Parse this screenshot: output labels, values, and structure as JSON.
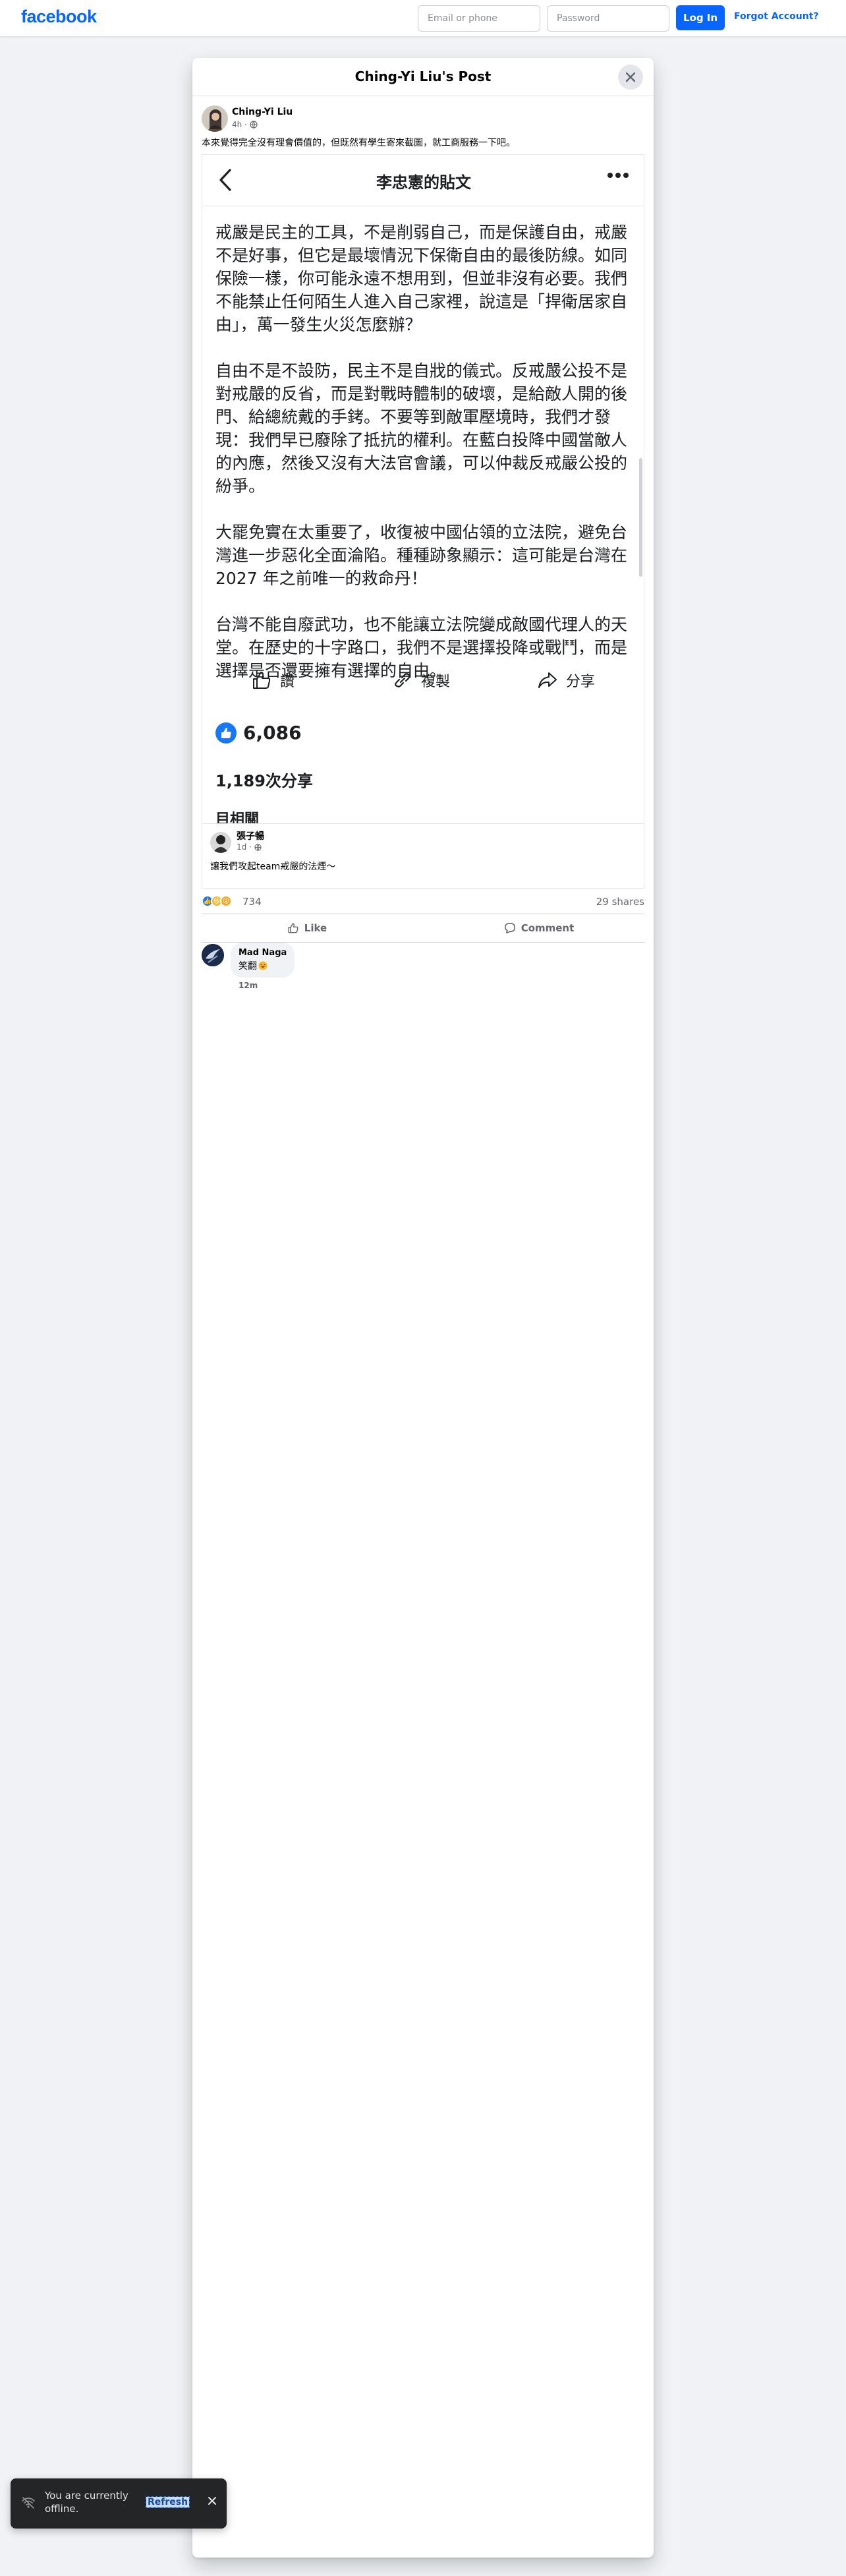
{
  "topbar": {
    "logo": "facebook",
    "email_placeholder": "Email or phone",
    "password_placeholder": "Password",
    "login_label": "Log In",
    "forgot_label": "Forgot Account?"
  },
  "modal": {
    "title": "Ching-Yi Liu's Post",
    "author": {
      "name": "Ching-Yi Liu",
      "meta": "4h ·"
    },
    "caption": "本來覺得完全沒有理會價值的，但既然有學生寄來截圖，就工商服務一下吧。",
    "embed": {
      "title": "李忠憲的貼文",
      "paragraphs": [
        "戒嚴是民主的工具，不是削弱自己，而是保護自由，戒嚴不是好事，但它是最壞情況下保衛自由的最後防線。如同保險一樣，你可能永遠不想用到，但並非沒有必要。我們不能禁止任何陌生人進入自己家裡，說這是「捍衛居家自由」，萬一發生火災怎麼辦？",
        "自由不是不設防，民主不是自戕的儀式。反戒嚴公投不是對戒嚴的反省，而是對戰時體制的破壞，是給敵人開的後門、給總統戴的手銬。不要等到敵軍壓境時，我們才發現：我們早已廢除了抵抗的權利。在藍白投降中國當敵人的內應，然後又沒有大法官會議，可以仲裁反戒嚴公投的紛爭。",
        "大罷免實在太重要了，收復被中國佔領的立法院，避免台灣進一步惡化全面淪陷。種種跡象顯示：這可能是台灣在 2027 年之前唯一的救命丹！",
        "台灣不能自廢武功，也不能讓立法院變成敵國代理人的天堂。在歷史的十字路口，我們不是選擇投降或戰鬥，而是選擇是否還要擁有選擇的自由。"
      ],
      "actions": {
        "like": "讚",
        "copy": "複製",
        "share": "分享"
      },
      "likes": "6,086",
      "shares": "1,189次分享",
      "related": "目相關",
      "comment": {
        "name": "張子暢",
        "meta": "1d ·",
        "text": "讓我們攻起team戒嚴的法煙〜"
      }
    },
    "reactions": {
      "count": "734",
      "shares": "29 shares"
    },
    "actions": {
      "like": "Like",
      "comment": "Comment"
    },
    "comment": {
      "name": "Mad Naga",
      "text": "笑翻",
      "time": "12m"
    }
  },
  "toast": {
    "text": "You are currently offline.",
    "refresh": "Refresh"
  },
  "colors": {
    "brand": "#0866ff",
    "like_blue": "#1877f2",
    "haha_yellow": "#f7b928",
    "wow_orange": "#f5a623"
  }
}
